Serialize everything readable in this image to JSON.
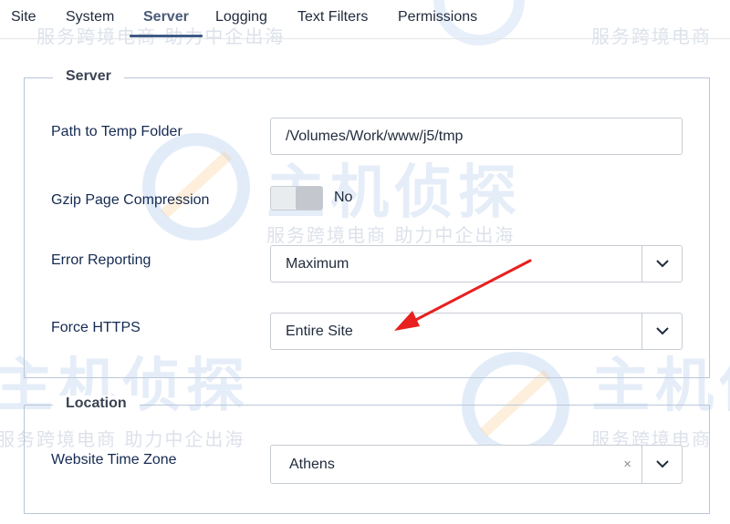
{
  "tabs": [
    {
      "label": "Site"
    },
    {
      "label": "System"
    },
    {
      "label": "Server"
    },
    {
      "label": "Logging"
    },
    {
      "label": "Text Filters"
    },
    {
      "label": "Permissions"
    }
  ],
  "active_tab": "Server",
  "server": {
    "legend": "Server",
    "temp_folder": {
      "label": "Path to Temp Folder",
      "value": "/Volumes/Work/www/j5/tmp"
    },
    "gzip": {
      "label": "Gzip Page Compression",
      "state": "No"
    },
    "error_reporting": {
      "label": "Error Reporting",
      "value": "Maximum"
    },
    "force_https": {
      "label": "Force HTTPS",
      "value": "Entire Site"
    }
  },
  "location": {
    "legend": "Location",
    "timezone": {
      "label": "Website Time Zone",
      "value": "Athens",
      "clear": "×"
    }
  },
  "watermark": {
    "big": "主机侦探",
    "sub": "服务跨境电商 助力中企出海",
    "sub_short": "服务跨境电商"
  },
  "colors": {
    "accent": "#3e5a86",
    "annotation_arrow": "#e8201f"
  }
}
